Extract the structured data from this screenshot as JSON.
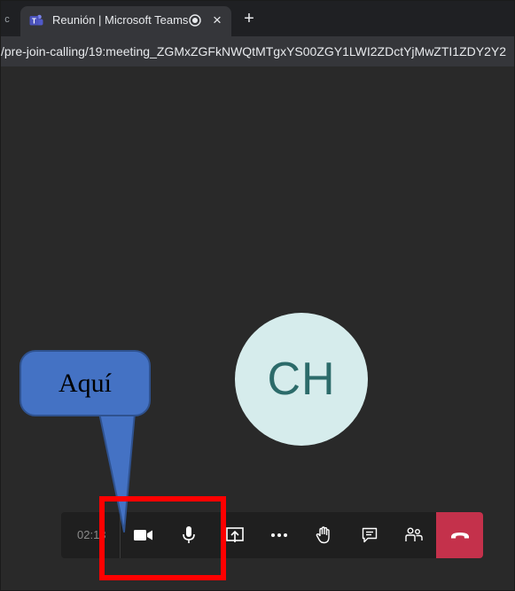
{
  "browser": {
    "tab_edge_glyph": "c",
    "tab_title": "Reunión | Microsoft Teams",
    "tab_close_glyph": "×",
    "new_tab_glyph": "+",
    "url": "/pre-join-calling/19:meeting_ZGMxZGFkNWQtMTgxYS00ZGY1LWI2ZDctYjMwZTI1ZDY2Y2"
  },
  "meeting": {
    "avatar_initials": "CH",
    "avatar_color": "#d6ecec",
    "initials_color": "#2c6b6a"
  },
  "controls": {
    "timer": "02:13",
    "buttons": [
      {
        "icon": "camera-icon"
      },
      {
        "icon": "microphone-icon"
      },
      {
        "icon": "share-screen-icon"
      },
      {
        "icon": "more-options-icon"
      },
      {
        "icon": "raise-hand-icon"
      },
      {
        "icon": "chat-icon"
      },
      {
        "icon": "participants-icon"
      },
      {
        "icon": "hang-up-icon"
      }
    ],
    "hangup_color": "#c4314b"
  },
  "annotation": {
    "callout_text": "Aquí",
    "callout_color": "#4472c4",
    "highlight_color": "#ff0000"
  }
}
